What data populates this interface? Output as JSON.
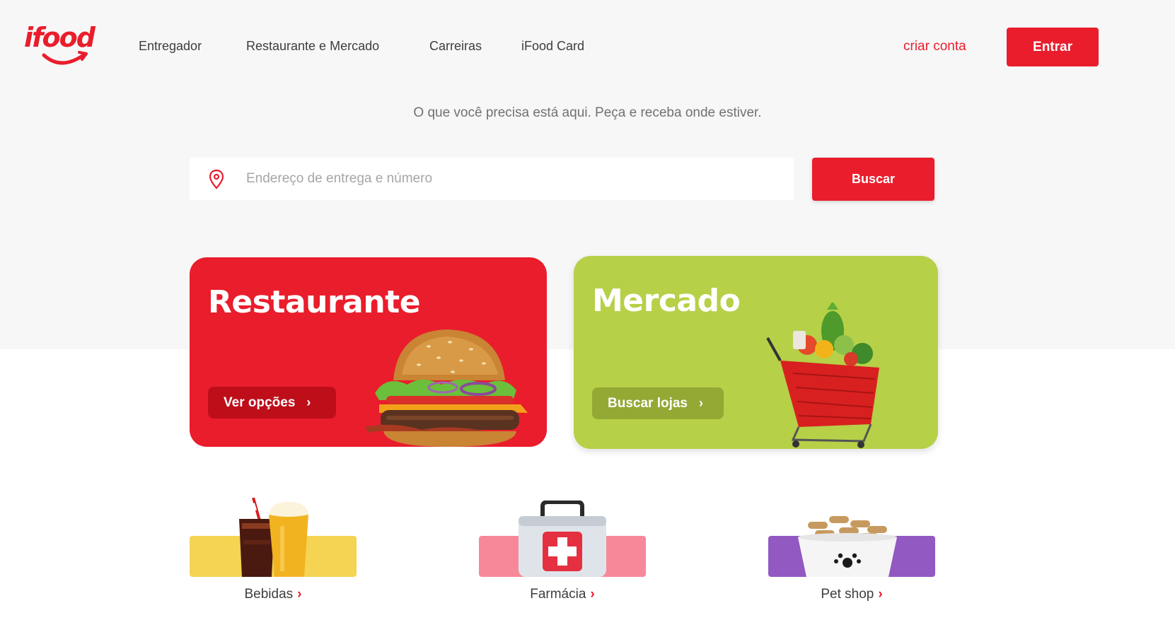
{
  "brand": {
    "name": "ifood",
    "color": "#ea1d2c"
  },
  "nav": {
    "items": [
      {
        "label": "Entregador"
      },
      {
        "label": "Restaurante e Mercado"
      },
      {
        "label": "Carreiras"
      },
      {
        "label": "iFood Card"
      }
    ],
    "create_account": "criar conta",
    "login": "Entrar"
  },
  "hero": {
    "tagline": "O que você precisa está aqui. Peça e receba onde estiver.",
    "search": {
      "placeholder": "Endereço de entrega e número",
      "value": "",
      "button": "Buscar",
      "icon": "location-pin-icon"
    }
  },
  "cards": [
    {
      "title": "Restaurante",
      "button": "Ver opções",
      "color": "#ea1d2c",
      "image": "burger"
    },
    {
      "title": "Mercado",
      "button": "Buscar lojas",
      "color": "#b6d048",
      "image": "shopping-cart"
    }
  ],
  "categories": [
    {
      "label": "Bebidas",
      "color": "#f4d452",
      "image": "drinks"
    },
    {
      "label": "Farmácia",
      "color": "#f7889a",
      "image": "first-aid-kit"
    },
    {
      "label": "Pet shop",
      "color": "#9159c1",
      "image": "pet-bowl"
    }
  ]
}
